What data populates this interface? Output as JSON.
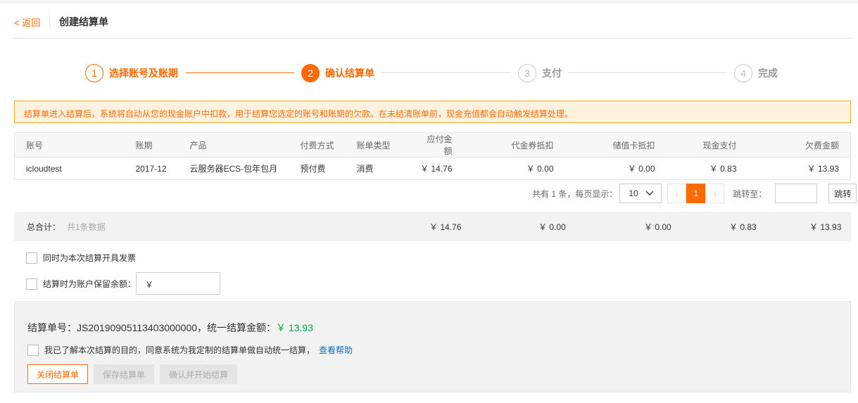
{
  "header": {
    "back_label": "< 返回",
    "title": "创建结算单"
  },
  "steps": [
    {
      "num": "1",
      "label": "选择账号及账期",
      "state": "done"
    },
    {
      "num": "2",
      "label": "确认结算单",
      "state": "active"
    },
    {
      "num": "3",
      "label": "支付",
      "state": "todo"
    },
    {
      "num": "4",
      "label": "完成",
      "state": "todo"
    }
  ],
  "notice": "结算单进入结算后，系统将自动从您的现金账户中扣款，用于结算您选定的账号和账期的欠款。在未结清账单前，现金充值都会自动触发结算处理。",
  "table": {
    "headers": [
      "账号",
      "账期",
      "产品",
      "付费方式",
      "账单类型",
      "应付金额",
      "代金券抵扣",
      "储值卡抵扣",
      "现金支付",
      "欠费金额"
    ],
    "rows": [
      [
        "icloudtest",
        "2017-12",
        "云服务器ECS-包年包月",
        "预付费",
        "消费",
        "￥ 14.76",
        "￥ 0.00",
        "￥ 0.00",
        "￥ 0.83",
        "￥ 13.93"
      ]
    ]
  },
  "pagination": {
    "summary": "共有 1 条，每页显示：",
    "page_size": "10",
    "prev": "‹",
    "current_page": "1",
    "next": "›",
    "jump_label": "跳转至：",
    "go_label": "跳转"
  },
  "totals": {
    "label": "总合计：",
    "count": "共1条数据",
    "payable": "￥ 14.76",
    "voucher": "￥ 0.00",
    "stored_card": "￥ 0.00",
    "cash": "￥ 0.83",
    "arrears": "￥ 13.93"
  },
  "options": {
    "invoice_label": "同时为本次结算开具发票",
    "reserve_label": "结算时为账户保留余额：",
    "reserve_value": "￥"
  },
  "panel": {
    "summary_prefix": "结算单号：JS20190905113403000000，统一结算金额：",
    "summary_amount": "￥ 13.93",
    "agree_text": "我已了解本次结算的目的，同意系统为我定制的结算单做自动统一结算，",
    "help_link": "查看帮助",
    "close_btn": "关闭结算单",
    "save_btn": "保存结算单",
    "confirm_btn": "确认并开始结算"
  },
  "colors": {
    "accent": "#ff6a00",
    "success": "#00a854",
    "link": "#0070cc"
  }
}
